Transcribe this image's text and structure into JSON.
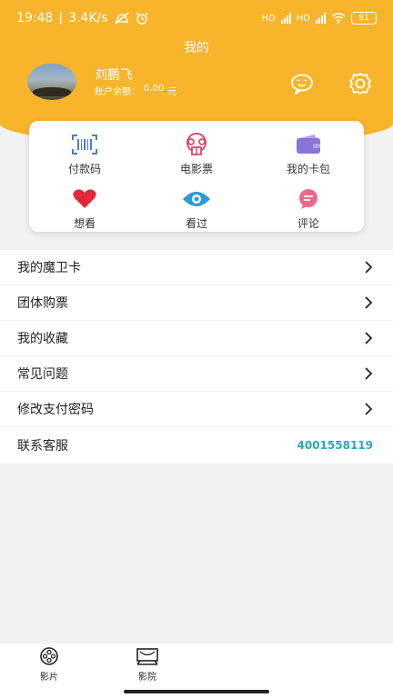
{
  "status_bar": {
    "time": "19:48",
    "separator": "|",
    "speed": "3.4K/s",
    "battery": "81",
    "hd1": "HD",
    "hd2": "HD"
  },
  "header": {
    "title": "我的"
  },
  "user": {
    "name": "刘鹏飞",
    "balance_label": "账户余额：",
    "balance_value": "0.00",
    "balance_unit": "元"
  },
  "quick_actions": [
    {
      "label": "付款码",
      "icon": "barcode-icon"
    },
    {
      "label": "电影票",
      "icon": "ticket-icon"
    },
    {
      "label": "我的卡包",
      "icon": "wallet-icon"
    },
    {
      "label": "想看",
      "icon": "heart-icon"
    },
    {
      "label": "看过",
      "icon": "eye-icon"
    },
    {
      "label": "评论",
      "icon": "comment-icon"
    }
  ],
  "menu": {
    "items": [
      {
        "label": "我的魔卫卡"
      },
      {
        "label": "团体购票"
      },
      {
        "label": "我的收藏"
      },
      {
        "label": "常见问题"
      },
      {
        "label": "修改支付密码"
      }
    ],
    "contact": {
      "label": "联系客服",
      "phone": "4001558119"
    }
  },
  "tabbar": {
    "tabs": [
      {
        "label": "影片",
        "icon": "film-reel-icon"
      },
      {
        "label": "影院",
        "icon": "cinema-screen-icon"
      }
    ]
  },
  "colors": {
    "brand": "#f8b42a",
    "phone": "#2aa5bb"
  }
}
